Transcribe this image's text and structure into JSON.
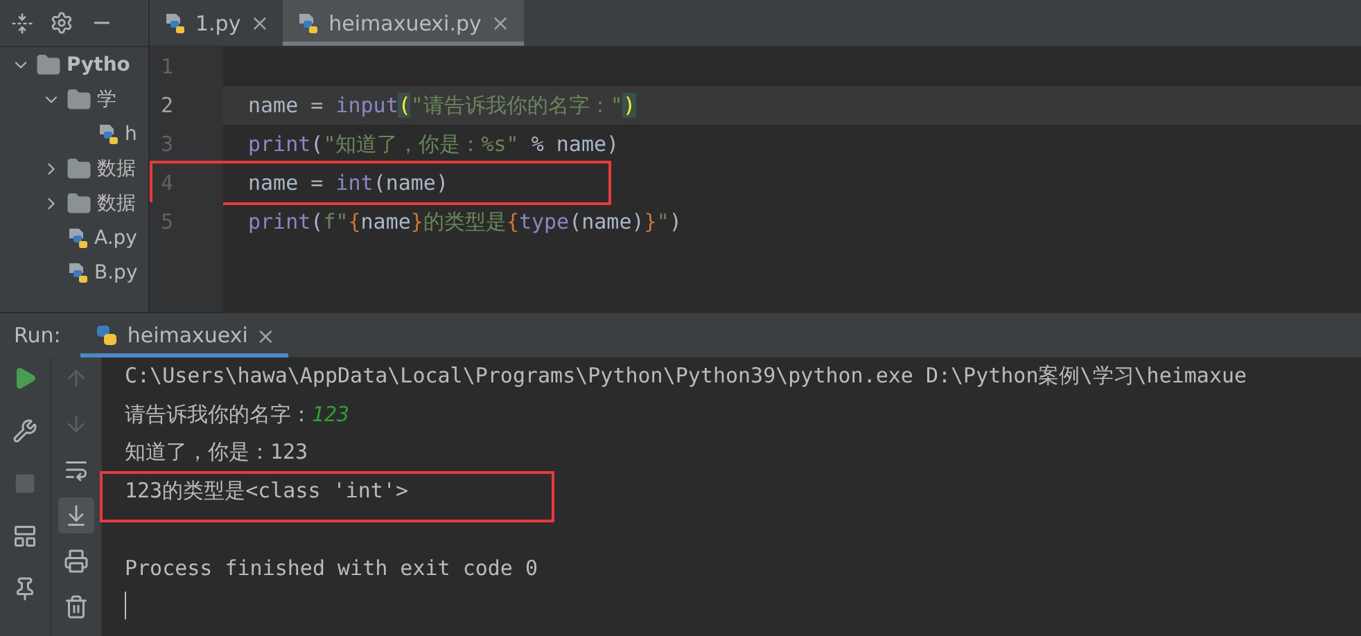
{
  "project_tree": [
    {
      "label": "Pytho",
      "kind": "folder",
      "expanded": true,
      "children": [
        {
          "label": "学",
          "kind": "folder",
          "expanded": true,
          "children": [
            {
              "label": "h",
              "kind": "file"
            }
          ]
        },
        {
          "label": "数据",
          "kind": "folder",
          "expanded": false
        },
        {
          "label": "数据",
          "kind": "folder",
          "expanded": false
        },
        {
          "label": "A.py",
          "kind": "file"
        },
        {
          "label": "B.py",
          "kind": "file"
        }
      ]
    }
  ],
  "editor_tabs": [
    {
      "label": "1.py",
      "close": "×",
      "selected": false
    },
    {
      "label": "heimaxuexi.py",
      "close": "×",
      "selected": true
    }
  ],
  "code_lines": [
    {
      "number": "1",
      "current": false,
      "highlighted": false
    },
    {
      "number": "2",
      "current": true,
      "highlighted": false,
      "tokens": [
        {
          "text": "name = ",
          "kind": "plain"
        },
        {
          "text": "input",
          "kind": "builtin"
        },
        {
          "text": "(",
          "kind": "match"
        },
        {
          "text": "\"请告诉我你的名字：\"",
          "kind": "string"
        },
        {
          "text": ")",
          "kind": "match"
        }
      ]
    },
    {
      "number": "3",
      "current": false,
      "highlighted": false,
      "tokens": [
        {
          "text": "print",
          "kind": "builtin"
        },
        {
          "text": "(",
          "kind": "plain"
        },
        {
          "text": "\"知道了，你是：%s\"",
          "kind": "string"
        },
        {
          "text": " % name)",
          "kind": "plain"
        }
      ]
    },
    {
      "number": "4",
      "current": false,
      "highlighted": true,
      "tokens": [
        {
          "text": "name = ",
          "kind": "plain"
        },
        {
          "text": "int",
          "kind": "builtin"
        },
        {
          "text": "(name)",
          "kind": "plain"
        }
      ]
    },
    {
      "number": "5",
      "current": false,
      "highlighted": false,
      "tokens": [
        {
          "text": "print",
          "kind": "builtin"
        },
        {
          "text": "(",
          "kind": "plain"
        },
        {
          "text": "f\"",
          "kind": "string"
        },
        {
          "text": "{",
          "kind": "brace"
        },
        {
          "text": "name",
          "kind": "plain"
        },
        {
          "text": "}",
          "kind": "brace"
        },
        {
          "text": "的类型是",
          "kind": "string"
        },
        {
          "text": "{",
          "kind": "brace"
        },
        {
          "text": "type",
          "kind": "builtin"
        },
        {
          "text": "(name)",
          "kind": "plain"
        },
        {
          "text": "}",
          "kind": "brace"
        },
        {
          "text": "\"",
          "kind": "string"
        },
        {
          "text": ")",
          "kind": "plain"
        }
      ]
    }
  ],
  "run_panel": {
    "label": "Run:",
    "tab": {
      "label": "heimaxuexi",
      "close": "×",
      "selected": true
    }
  },
  "console_lines": [
    {
      "kind": "text",
      "highlighted": false,
      "text": "C:\\Users\\hawa\\AppData\\Local\\Programs\\Python\\Python39\\python.exe D:\\Python案例\\学习\\heimaxue"
    },
    {
      "kind": "prompt",
      "highlighted": false,
      "text": "请告诉我你的名字：",
      "input": "123"
    },
    {
      "kind": "text",
      "highlighted": false,
      "text": "知道了，你是：123"
    },
    {
      "kind": "text",
      "highlighted": true,
      "text": "123的类型是<class 'int'>"
    },
    {
      "kind": "blank",
      "highlighted": false
    },
    {
      "kind": "text",
      "highlighted": false,
      "text": "Process finished with exit code 0"
    },
    {
      "kind": "cursor",
      "highlighted": false
    }
  ]
}
